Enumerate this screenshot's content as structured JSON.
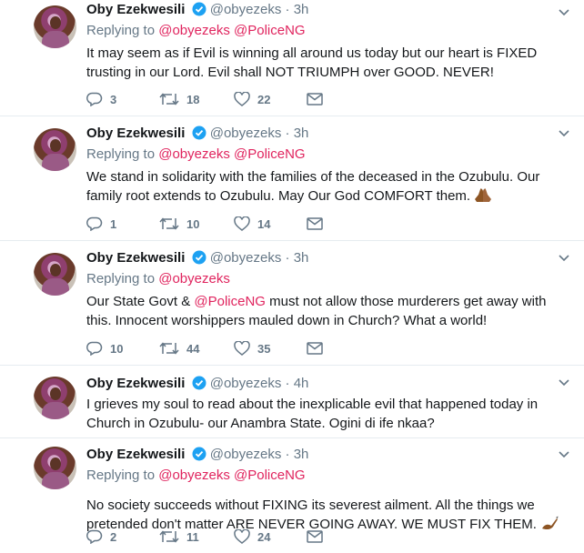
{
  "tweets": [
    {
      "name": "Oby Ezekwesili",
      "handle": "@obyezeks",
      "time": "3h",
      "replying_label": "Replying to",
      "replying": [
        "@obyezeks",
        "@PoliceNG"
      ],
      "text": "It may seem as if Evil is winning all around us today but our heart is FIXED trusting in our Lord. Evil shall NOT TRIUMPH over GOOD. NEVER!",
      "replies": "3",
      "retweets": "18",
      "likes": "22"
    },
    {
      "name": "Oby Ezekwesili",
      "handle": "@obyezeks",
      "time": "3h",
      "replying_label": "Replying to",
      "replying": [
        "@obyezeks",
        "@PoliceNG"
      ],
      "text": "We stand in solidarity with the families of the deceased in the Ozubulu. Our family root extends to Ozubulu. May Our God COMFORT them.",
      "emoji": "praying-hands",
      "replies": "1",
      "retweets": "10",
      "likes": "14"
    },
    {
      "name": "Oby Ezekwesili",
      "handle": "@obyezeks",
      "time": "3h",
      "replying_label": "Replying to",
      "replying": [
        "@obyezeks"
      ],
      "text_before": "Our State Govt & ",
      "text_mention": "@PoliceNG",
      "text_after": " must not allow those murderers get away with this. Innocent worshippers mauled down in Church? What a world!",
      "replies": "10",
      "retweets": "44",
      "likes": "35"
    },
    {
      "name": "Oby Ezekwesili",
      "handle": "@obyezeks",
      "time": "4h",
      "text": "I grieves my soul to read about the inexplicable evil that happened today in Church in Ozubulu- our Anambra State. Ogini di ife nkaa?"
    },
    {
      "name": "Oby Ezekwesili",
      "handle": "@obyezeks",
      "time": "3h",
      "replying_label": "Replying to",
      "replying": [
        "@obyezeks",
        "@PoliceNG"
      ],
      "text": "No society succeeds without FIXING its severest ailment. All the things we pretended don't matter ARE NEVER GOING AWAY. WE MUST FIX THEM.",
      "emoji": "writing-hand",
      "replies": "2",
      "retweets": "11",
      "likes": "24"
    }
  ],
  "separator": "·",
  "colors": {
    "mention": "#e0245e",
    "muted": "#657786",
    "verified": "#1da1f2",
    "divider": "#e6ecf0"
  }
}
